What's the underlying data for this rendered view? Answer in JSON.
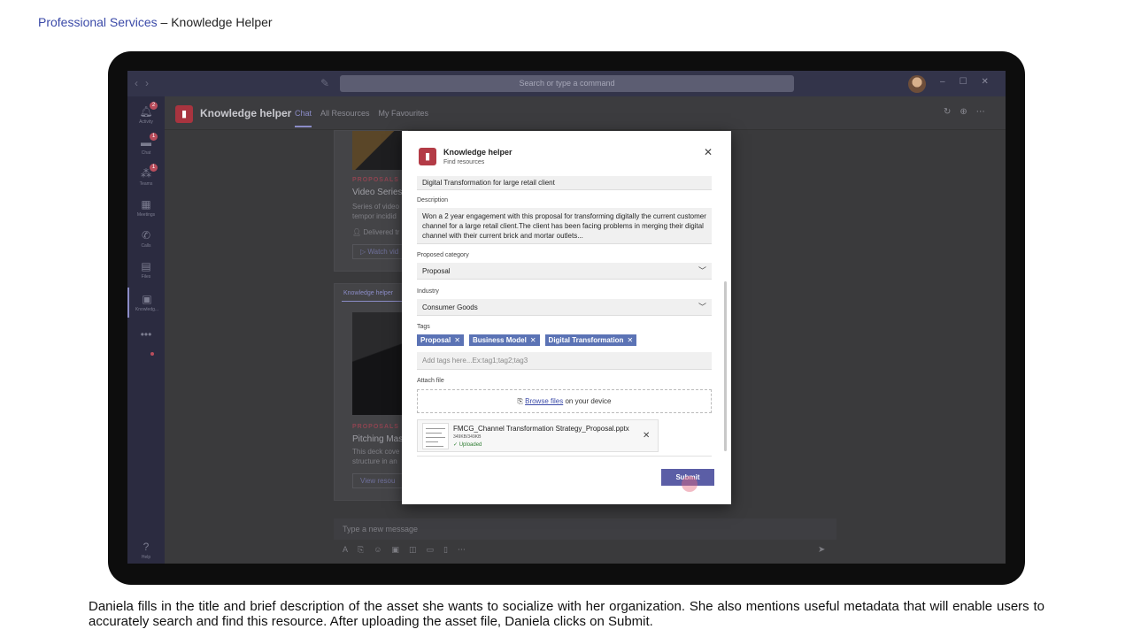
{
  "slide": {
    "brand": "Professional Services",
    "heading": " – Knowledge  Helper",
    "caption": "Daniela fills in the title and brief description of the asset she wants to socialize with her organization. She also mentions useful metadata that will enable users to accurately search and find this resource. After uploading the asset file, Daniela clicks on Submit."
  },
  "titlebar": {
    "search_placeholder": "Search or type a command",
    "back_icon": "chevron-left-icon",
    "forward_icon": "chevron-right-icon"
  },
  "rail": {
    "items": [
      {
        "label": "Activity",
        "icon": "bell-icon",
        "badge": "2"
      },
      {
        "label": "Chat",
        "icon": "chat-icon",
        "badge": "1"
      },
      {
        "label": "Teams",
        "icon": "teams-icon",
        "badge": "1"
      },
      {
        "label": "Meetings",
        "icon": "calendar-icon",
        "badge": ""
      },
      {
        "label": "Calls",
        "icon": "phone-icon",
        "badge": ""
      },
      {
        "label": "Files",
        "icon": "file-icon",
        "badge": ""
      },
      {
        "label": "Knowledg...",
        "icon": "knowledge-icon",
        "badge": ""
      }
    ],
    "more_icon": "more-icon",
    "help_label": "Help"
  },
  "app": {
    "title": "Knowledge helper",
    "tabs": [
      "Chat",
      "All Resources",
      "My Favourites"
    ],
    "active_tab": "Chat"
  },
  "feed": {
    "cards": [
      {
        "category": "PROPOSALS",
        "title": "Video Series:",
        "text1": "Series of video",
        "text2": "tempor incidid",
        "meta": "Delivered tr",
        "button": "Watch vid"
      },
      {
        "header": "Knowledge helper",
        "category": "PROPOSALS",
        "title": "Pitching Mas",
        "text1": "This deck cove",
        "text2": "structure in an",
        "button": "View resou"
      }
    ],
    "message_placeholder": "Type a new message"
  },
  "dialog": {
    "title": "Knowledge helper",
    "subtitle": "Find resources",
    "title_value": "Digital Transformation for large retail client",
    "description_label": "Description",
    "description_value": "Won a 2 year engagement with this proposal for transforming digitally the current customer channel for a large retail client.The client has been facing problems in merging their digital channel with their current brick and mortar outlets...",
    "category_label": "Proposed category",
    "category_value": "Proposal",
    "industry_label": "Industry",
    "industry_value": "Consumer Goods",
    "tags_label": "Tags",
    "tags": [
      "Proposal",
      "Business Model",
      "Digital Transformation"
    ],
    "tags_placeholder": "Add tags here...Ex:tag1;tag2;tag3",
    "attach_label": "Attach file",
    "browse_link": "Browse files",
    "browse_suffix": " on your device",
    "file": {
      "name": "FMCG_Channel Transformation Strategy_Proposal.pptx",
      "size": "349KB/349KB",
      "status": "Uploaded"
    },
    "submit_label": "Submit"
  },
  "colors": {
    "brand_link": "#3b4aa8",
    "app_accent": "#a8343f",
    "tag_bg": "#5b73b5",
    "submit_bg": "#5b5ea6",
    "uploaded": "#2e7d32"
  }
}
